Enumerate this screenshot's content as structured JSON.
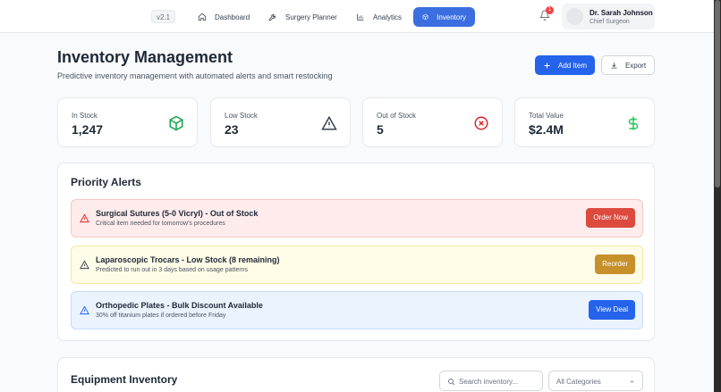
{
  "nav": {
    "version": "v2.1",
    "items": [
      {
        "label": "Dashboard",
        "icon": "home-icon"
      },
      {
        "label": "Surgery Planner",
        "icon": "wrench-icon"
      },
      {
        "label": "Analytics",
        "icon": "bar-chart-icon"
      },
      {
        "label": "Inventory",
        "icon": "box-icon",
        "active": true
      }
    ],
    "notification_count": "1",
    "user": {
      "name": "Dr. Sarah Johnson",
      "role": "Chief Surgeon"
    }
  },
  "header": {
    "title": "Inventory Management",
    "subtitle": "Predictive inventory management with automated alerts and smart restocking",
    "add_label": "Add Item",
    "export_label": "Export"
  },
  "stats": [
    {
      "label": "In Stock",
      "value": "1,247",
      "icon": "box-icon",
      "color": "#16a34a"
    },
    {
      "label": "Low Stock",
      "value": "23",
      "icon": "warning-icon",
      "color": "#374151"
    },
    {
      "label": "Out of Stock",
      "value": "5",
      "icon": "x-circle-icon",
      "color": "#dc2626"
    },
    {
      "label": "Total Value",
      "value": "$2.4M",
      "icon": "dollar-icon",
      "color": "#22c55e"
    }
  ],
  "alerts": {
    "title": "Priority Alerts",
    "items": [
      {
        "title": "Surgical Sutures (5-0 Vicryl) - Out of Stock",
        "subtitle": "Critical item needed for tomorrow's procedures",
        "action": "Order Now",
        "color": "#dc4a3e"
      },
      {
        "title": "Laparoscopic Trocars - Low Stock (8 remaining)",
        "subtitle": "Predicted to run out in 3 days based on usage patterns",
        "action": "Reorder",
        "color": "#c7902b"
      },
      {
        "title": "Orthopedic Plates - Bulk Discount Available",
        "subtitle": "30% off titanium plates if ordered before Friday",
        "action": "View Deal",
        "color": "#2563eb"
      }
    ]
  },
  "equipment": {
    "title": "Equipment Inventory",
    "search_placeholder": "Search inventory...",
    "category_selected": "All Categories"
  }
}
